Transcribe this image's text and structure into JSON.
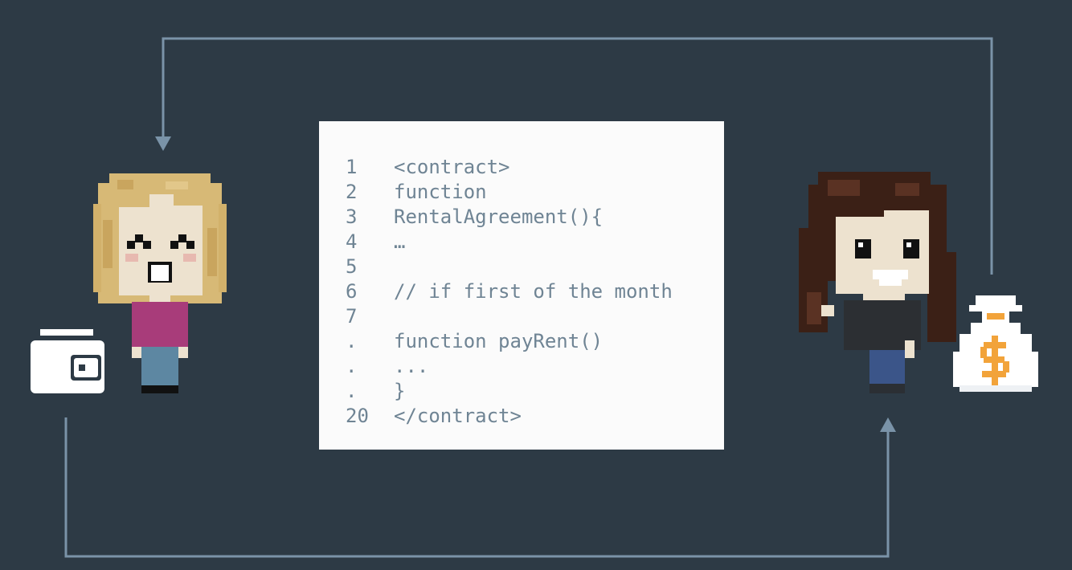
{
  "colors": {
    "background": "#2d3a45",
    "arrow": "#7a93a8",
    "card": "#fbfbfb",
    "code_text": "#6f8494",
    "wallet": "#ffffff",
    "money_symbol": "#f2a33a"
  },
  "icons": [
    "tenant-avatar",
    "wallet-icon",
    "landlord-avatar",
    "money-bag-icon",
    "dollar-icon"
  ],
  "code_lines": [
    {
      "num": "1",
      "text": "<contract>"
    },
    {
      "num": "2",
      "text": "function"
    },
    {
      "num": "3",
      "text": "RentalAgreement(){"
    },
    {
      "num": "4",
      "text": "…"
    },
    {
      "num": "5",
      "text": ""
    },
    {
      "num": "6",
      "text": "// if first of the month"
    },
    {
      "num": "7",
      "text": ""
    },
    {
      "num": ".",
      "text": "function payRent()"
    },
    {
      "num": ".",
      "text": "..."
    },
    {
      "num": ".",
      "text": "}"
    },
    {
      "num": "20",
      "text": "</contract>"
    }
  ]
}
